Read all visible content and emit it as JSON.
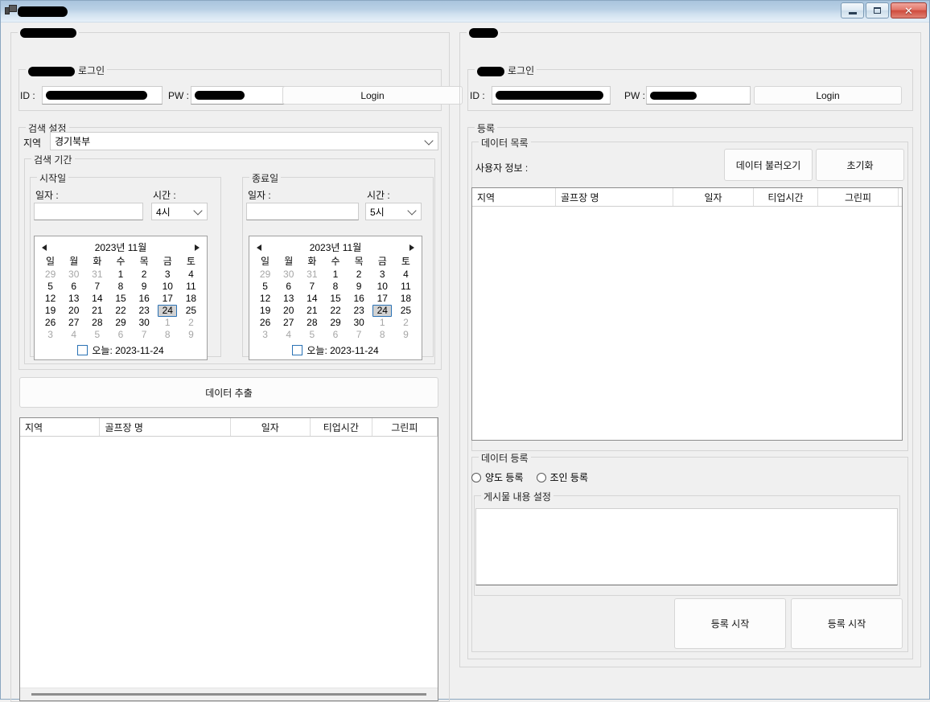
{
  "window": {
    "title_redacted": true,
    "title": "",
    "icon": "app-icon",
    "buttons": {
      "minimize": "minimize-icon",
      "maximize": "maximize-icon",
      "close": "✕"
    }
  },
  "left_panel": {
    "outer_group_title_redacted": true,
    "login_group": {
      "title_prefix_redacted": true,
      "title_suffix": "로그인",
      "id_label": "ID :",
      "id_value_redacted": true,
      "id_value": "",
      "pw_label": "PW :",
      "pw_value_redacted": true,
      "pw_value": "",
      "login_button": "Login"
    },
    "search_settings": {
      "title": "검색 설정",
      "region_label": "지역",
      "region_value": "경기북부",
      "period": {
        "title": "검색 기간",
        "start": {
          "title": "시작일",
          "date_label": "일자 :",
          "date_value": "",
          "time_label": "시간 :",
          "time_value": "4시",
          "calendar": {
            "header": "2023년 11월",
            "selected": 24,
            "today_label": "오늘: 2023-11-24"
          }
        },
        "end": {
          "title": "종료일",
          "date_label": "일자 :",
          "date_value": "",
          "time_label": "시간 :",
          "time_value": "5시",
          "calendar": {
            "header": "2023년 11월",
            "selected": 24,
            "today_label": "오늘: 2023-11-24"
          }
        }
      }
    },
    "extract_button": "데이터 추출",
    "result_grid": {
      "columns": [
        "지역",
        "골프장 명",
        "일자",
        "티업시간",
        "그린피"
      ],
      "rows": []
    }
  },
  "right_panel": {
    "outer_group_title_redacted": true,
    "login_group": {
      "title_prefix_redacted": true,
      "title_suffix": "로그인",
      "id_label": "ID :",
      "id_value_redacted": true,
      "id_value": "",
      "pw_label": "PW :",
      "pw_value_redacted": true,
      "pw_value": "",
      "login_button": "Login"
    },
    "register": {
      "title": "등록",
      "data_list": {
        "title": "데이터 목록",
        "user_info_label": "사용자 정보 :",
        "user_info_value": "",
        "load_button": "데이터 불러오기",
        "reset_button": "초기화",
        "columns": [
          "지역",
          "골프장 명",
          "일자",
          "티업시간",
          "그린피"
        ],
        "rows": []
      },
      "data_register": {
        "title": "데이터 등록",
        "radios": [
          {
            "label": "양도 등록",
            "checked": false
          },
          {
            "label": "조인 등록",
            "checked": false
          }
        ],
        "content_group_title": "게시물 내용 설정",
        "content_value": "",
        "start_button_1": "등록 시작",
        "start_button_2": "등록 시작"
      }
    }
  },
  "calendar_common": {
    "dow": [
      "일",
      "월",
      "화",
      "수",
      "목",
      "금",
      "토"
    ],
    "weeks": [
      [
        {
          "d": 29,
          "dim": true
        },
        {
          "d": 30,
          "dim": true
        },
        {
          "d": 31,
          "dim": true
        },
        {
          "d": 1
        },
        {
          "d": 2
        },
        {
          "d": 3
        },
        {
          "d": 4
        }
      ],
      [
        {
          "d": 5
        },
        {
          "d": 6
        },
        {
          "d": 7
        },
        {
          "d": 8
        },
        {
          "d": 9
        },
        {
          "d": 10
        },
        {
          "d": 11
        }
      ],
      [
        {
          "d": 12
        },
        {
          "d": 13
        },
        {
          "d": 14
        },
        {
          "d": 15
        },
        {
          "d": 16
        },
        {
          "d": 17
        },
        {
          "d": 18
        }
      ],
      [
        {
          "d": 19
        },
        {
          "d": 20
        },
        {
          "d": 21
        },
        {
          "d": 22
        },
        {
          "d": 23
        },
        {
          "d": 24,
          "sel": true
        },
        {
          "d": 25
        }
      ],
      [
        {
          "d": 26
        },
        {
          "d": 27
        },
        {
          "d": 28
        },
        {
          "d": 29
        },
        {
          "d": 30
        },
        {
          "d": 1,
          "dim": true
        },
        {
          "d": 2,
          "dim": true
        }
      ],
      [
        {
          "d": 3,
          "dim": true
        },
        {
          "d": 4,
          "dim": true
        },
        {
          "d": 5,
          "dim": true
        },
        {
          "d": 6,
          "dim": true
        },
        {
          "d": 7,
          "dim": true
        },
        {
          "d": 8,
          "dim": true
        },
        {
          "d": 9,
          "dim": true
        }
      ]
    ]
  },
  "colors": {
    "window_bg": "#f0f0f0",
    "titlebar": "#b9d0e5",
    "close_button": "#cf4c3e",
    "selection_border": "#2a72b5",
    "selection_fill": "#d2d2d2",
    "groupbox_border": "#d5d5d5"
  }
}
